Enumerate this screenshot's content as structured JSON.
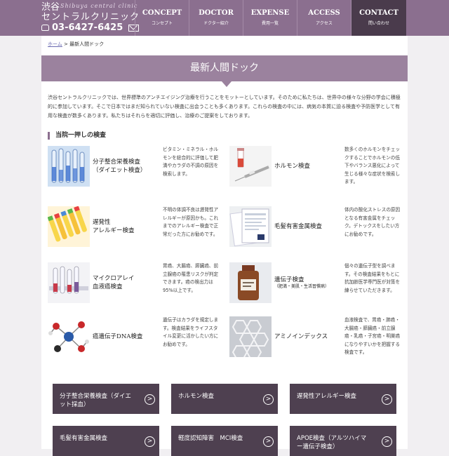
{
  "header": {
    "logo_line1": "渋谷",
    "logo_line2": "セントラルクリニック",
    "logo_en": "Shibuya central clinic",
    "phone": "03-6427-6425",
    "colors": {
      "header": "#8b6f8f",
      "active_nav": "#4a3b4c"
    }
  },
  "nav": [
    {
      "en": "CONCEPT",
      "jp": "コンセプト"
    },
    {
      "en": "DOCTOR",
      "jp": "ドクター紹介"
    },
    {
      "en": "EXPENSE",
      "jp": "費用一覧"
    },
    {
      "en": "ACCESS",
      "jp": "アクセス"
    },
    {
      "en": "CONTACT",
      "jp": "問い合わせ"
    }
  ],
  "breadcrumb": {
    "home": "ホーム",
    "sep": ">",
    "current": "最新人間ドック"
  },
  "page_title": "最新人間ドック",
  "intro": "渋谷セントラルクリニックでは、世界標準のアンチエイジング治療を行うことをモットーとしています。そのために私たちは、世界中の様々な分野の学会に積極的に参加しています。そこで日本ではまだ知られていない検査に出会うことも多くあります。これらの検査の中には、病気の本質に迫る検査や予防医学として有用な検査が数多くあります。私たちはそれらを適切に評価し、治療のご提案をしております。",
  "section_heading": "当院一押しの検査",
  "cards": [
    {
      "name1": "分子整合栄養検査",
      "name2": "（ダイエット検査）",
      "sub": "",
      "desc": "ビタミン・ミネラル・ホルモンを総合的に評価して肥満やカラダの不調の原因を検索します。",
      "icon": "test-tubes-icon"
    },
    {
      "name1": "ホルモン検査",
      "name2": "",
      "sub": "",
      "desc": "数多くのホルモンをチェックすることでホルモンの低下やバランス悪化によって生じる様々な症状を検索します。",
      "icon": "syringe-icon"
    },
    {
      "name1": "遅発性",
      "name2": "アレルギー検査",
      "sub": "",
      "desc": "不明の体調不良は遅発性アレルギーが原因かも。これまでのアレルギー検査で正常だった方にお勧めです。",
      "icon": "vials-icon"
    },
    {
      "name1": "毛髪有害金属検査",
      "name2": "",
      "sub": "",
      "desc": "体内の酸化ストレスの原因となる有害金属をチェック。デトックスをしたい方にお勧めです。",
      "icon": "report-icon"
    },
    {
      "name1": "マイクロアレイ",
      "name2": "血液癌検査",
      "sub": "",
      "desc": "胃癌、大腸癌、膵臓癌、前立腺癌の罹患リスクが判定できます。癌の検出力は95%以上です。",
      "icon": "lab-tubes-icon"
    },
    {
      "name1": "遺伝子検査",
      "name2": "",
      "sub": "（肥満・美肌・生活習慣病）",
      "desc": "個々の遺伝子型を調べます。その検査結果をもとに抗加齢医学専門医が対策を練らせていただきます。",
      "icon": "bottle-icon"
    },
    {
      "name1": "癌遺伝子DNA検査",
      "name2": "",
      "sub": "",
      "desc": "遺伝子はカラダを規定します。検査結果をライフスタイル変更に活かしたい方にお勧めです。",
      "icon": "molecule-icon"
    },
    {
      "name1": "アミノインデックス",
      "name2": "",
      "sub": "",
      "desc": "血液検査で、胃癌・肺癌・大腸癌・膵臓癌・前立腺癌・乳癌・子宮癌・明巣癌になりやすいかを把握する検査です。",
      "icon": "lattice-icon"
    }
  ],
  "buttons": [
    {
      "line1": "分子整合栄養検査（ダイエ",
      "line2": "ット採血）"
    },
    {
      "line1": "ホルモン検査",
      "line2": ""
    },
    {
      "line1": "遅発性アレルギー検査",
      "line2": ""
    },
    {
      "line1": "毛髪有害金属検査",
      "line2": ""
    },
    {
      "line1": "軽度認知障害　MCI検査",
      "line2": ""
    },
    {
      "line1": "APOE検査（アルツハイマ",
      "line2": "ー遺伝子検査）"
    }
  ],
  "go_glyph": ">"
}
